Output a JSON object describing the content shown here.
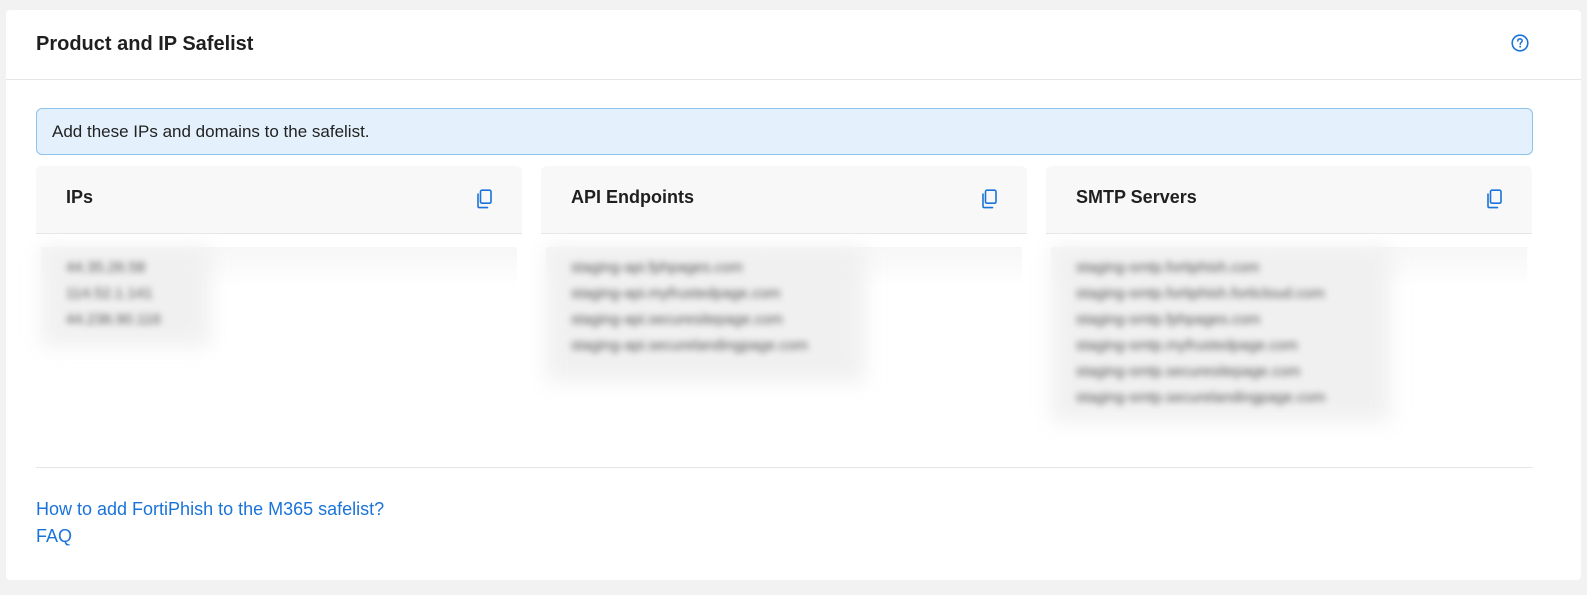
{
  "card": {
    "title": "Product and IP Safelist",
    "help_icon": "question-circle-icon"
  },
  "banner": {
    "text": "Add these IPs and domains to the safelist."
  },
  "panels": [
    {
      "title": "IPs",
      "copy_icon": "copy-icon",
      "items": [
        "44.35.26.58",
        "114.52.1.141",
        "44.236.90.116"
      ]
    },
    {
      "title": "API Endpoints",
      "copy_icon": "copy-icon",
      "items": [
        "staging-api.fphpages.com",
        "staging-api.myfrustedpage.com",
        "staging-api.securesitepage.com",
        "staging-api.securelandingpage.com"
      ]
    },
    {
      "title": "SMTP Servers",
      "copy_icon": "copy-icon",
      "items": [
        "staging-smtp.fortiphish.com",
        "staging-smtp.fortiphish.forticloud.com",
        "staging-smtp.fphpages.com",
        "staging-smtp.myfrustedpage.com",
        "staging-smtp.securesitepage.com",
        "staging-smtp.securelandingpage.com"
      ]
    }
  ],
  "links": {
    "m365_help": "How to add FortiPhish to the M365 safelist?",
    "faq": "FAQ"
  },
  "colors": {
    "accent": "#1a73d9",
    "banner_bg": "#e4f1fc",
    "banner_border": "#8cc4ee"
  }
}
